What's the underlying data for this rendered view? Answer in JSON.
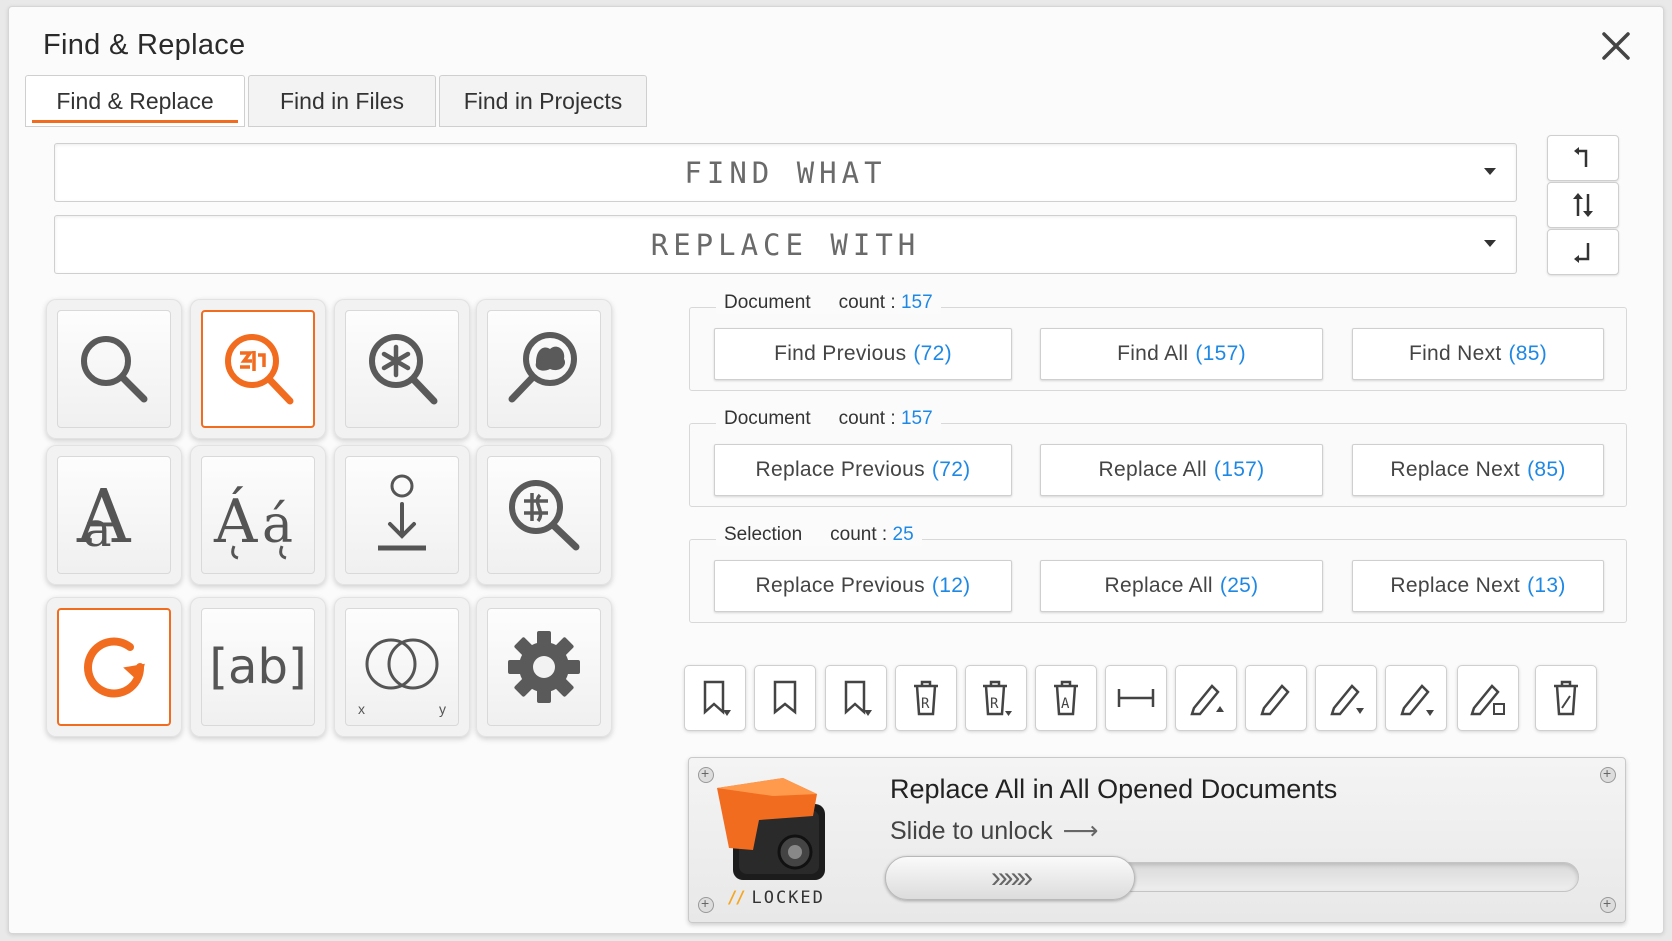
{
  "window": {
    "title": "Find & Replace",
    "close_icon": "close-icon"
  },
  "tabs": [
    {
      "label": "Find & Replace",
      "active": true
    },
    {
      "label": "Find in Files",
      "active": false
    },
    {
      "label": "Find in Projects",
      "active": false
    }
  ],
  "find": {
    "placeholder": "FIND WHAT",
    "value": ""
  },
  "replace": {
    "placeholder": "REPLACE WITH",
    "value": ""
  },
  "side_buttons": [
    "swap-up-icon",
    "swap-icon",
    "swap-down-icon"
  ],
  "icon_grid": [
    "search-icon",
    "regex-search-icon",
    "wildcard-search-icon",
    "fuzzy-search-icon",
    "match-case-icon",
    "diacritics-icon",
    "download-icon",
    "special-chars-search-icon",
    "wrap-around-icon",
    "whole-word-icon",
    "intersection-icon",
    "settings-icon"
  ],
  "icon_grid_text": {
    "whole_word": "[ab]",
    "venn_x": "x",
    "venn_y": "y"
  },
  "groups": [
    {
      "scope": "Document",
      "count_label": "count :",
      "count": "157",
      "buttons": [
        {
          "label": "Find Previous",
          "num": "(72)"
        },
        {
          "label": "Find All",
          "num": "(157)"
        },
        {
          "label": "Find Next",
          "num": "(85)"
        }
      ]
    },
    {
      "scope": "Document",
      "count_label": "count :",
      "count": "157",
      "buttons": [
        {
          "label": "Replace Previous",
          "num": "(72)"
        },
        {
          "label": "Replace All",
          "num": "(157)"
        },
        {
          "label": "Replace Next",
          "num": "(85)"
        }
      ]
    },
    {
      "scope": "Selection",
      "count_label": "count :",
      "count": "25",
      "buttons": [
        {
          "label": "Replace Previous",
          "num": "(12)"
        },
        {
          "label": "Replace All",
          "num": "(25)"
        },
        {
          "label": "Replace Next",
          "num": "(13)"
        }
      ]
    }
  ],
  "toolbar": [
    "bookmark-add-icon",
    "bookmark-icon",
    "bookmark-menu-icon",
    "bookmark-delete-icon",
    "bookmark-delete-menu-icon",
    "delete-all-icon",
    "range-icon",
    "highlight-add-icon",
    "highlight-icon",
    "highlight-menu-icon",
    "highlight-menu-alt-icon",
    "highlight-clear-icon",
    "trash-icon"
  ],
  "lock_panel": {
    "title": "Replace All in All Opened Documents",
    "subtitle": "Slide to unlock",
    "subtitle_arrow": "⟶",
    "status": "LOCKED",
    "status_stripes": "//",
    "thumb_glyph": "»»»",
    "progress": 0
  },
  "colors": {
    "accent": "#f26c1f",
    "count_blue": "#1e88e5"
  }
}
